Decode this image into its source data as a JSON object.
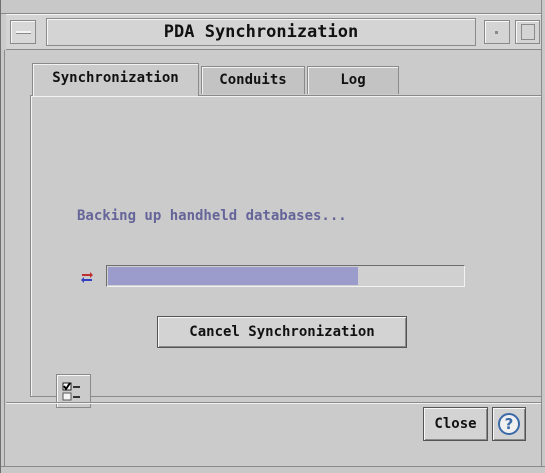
{
  "window": {
    "title": "PDA Synchronization"
  },
  "tabs": [
    {
      "label": "Synchronization",
      "active": true
    },
    {
      "label": "Conduits",
      "active": false
    },
    {
      "label": "Log",
      "active": false
    }
  ],
  "sync_panel": {
    "status_text": "Backing up handheld databases...",
    "progress_fraction": 0.7,
    "cancel_label": "Cancel Synchronization"
  },
  "footer": {
    "close_label": "Close",
    "help_glyph": "?"
  },
  "icons": {
    "sync": "sync-arrows-icon",
    "checklist": "checklist-icon",
    "help": "help-icon",
    "window_menu": "window-menu-icon",
    "minimize": "minimize-icon",
    "maximize": "maximize-icon"
  },
  "colors": {
    "status_text": "#65659a",
    "progress_fill": "#9b9bcc",
    "help_icon": "#3a6aa8"
  }
}
